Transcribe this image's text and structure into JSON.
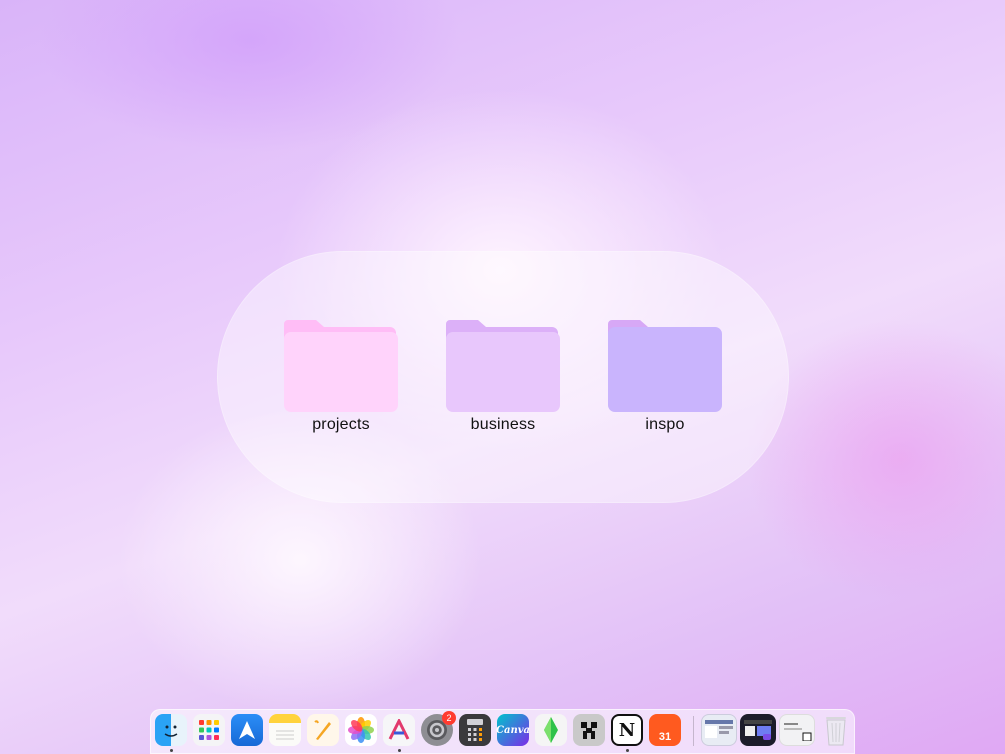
{
  "desktop": {
    "folders": [
      {
        "label": "projects",
        "color": "#ffd3fb",
        "tab": "#ffbdf6"
      },
      {
        "label": "business",
        "color": "#e8c7fc",
        "tab": "#dcb0f8"
      },
      {
        "label": "inspo",
        "color": "#c9b4fd",
        "tab": "#d7a8f6"
      }
    ]
  },
  "dock": {
    "apps": [
      {
        "name": "Finder",
        "icon": "finder-icon"
      },
      {
        "name": "Launchpad",
        "icon": "launchpad-icon"
      },
      {
        "name": "Spark Mail",
        "icon": "paper-plane-icon"
      },
      {
        "name": "Notes",
        "icon": "notes-icon"
      },
      {
        "name": "Pages",
        "icon": "pages-icon"
      },
      {
        "name": "Photos",
        "icon": "photos-icon"
      },
      {
        "name": "Affinity",
        "icon": "affinity-icon"
      },
      {
        "name": "System Settings",
        "icon": "gear-icon",
        "badge": "2"
      },
      {
        "name": "Calculator",
        "icon": "calculator-icon"
      },
      {
        "name": "Canva",
        "icon": "canva-icon",
        "text": "Canva"
      },
      {
        "name": "The Sims",
        "icon": "plumbob-icon"
      },
      {
        "name": "Minecraft",
        "icon": "creeper-icon"
      },
      {
        "name": "Notion",
        "icon": "notion-icon",
        "text": "N"
      },
      {
        "name": "Calendar",
        "icon": "calendar-icon",
        "text": "31"
      }
    ]
  }
}
